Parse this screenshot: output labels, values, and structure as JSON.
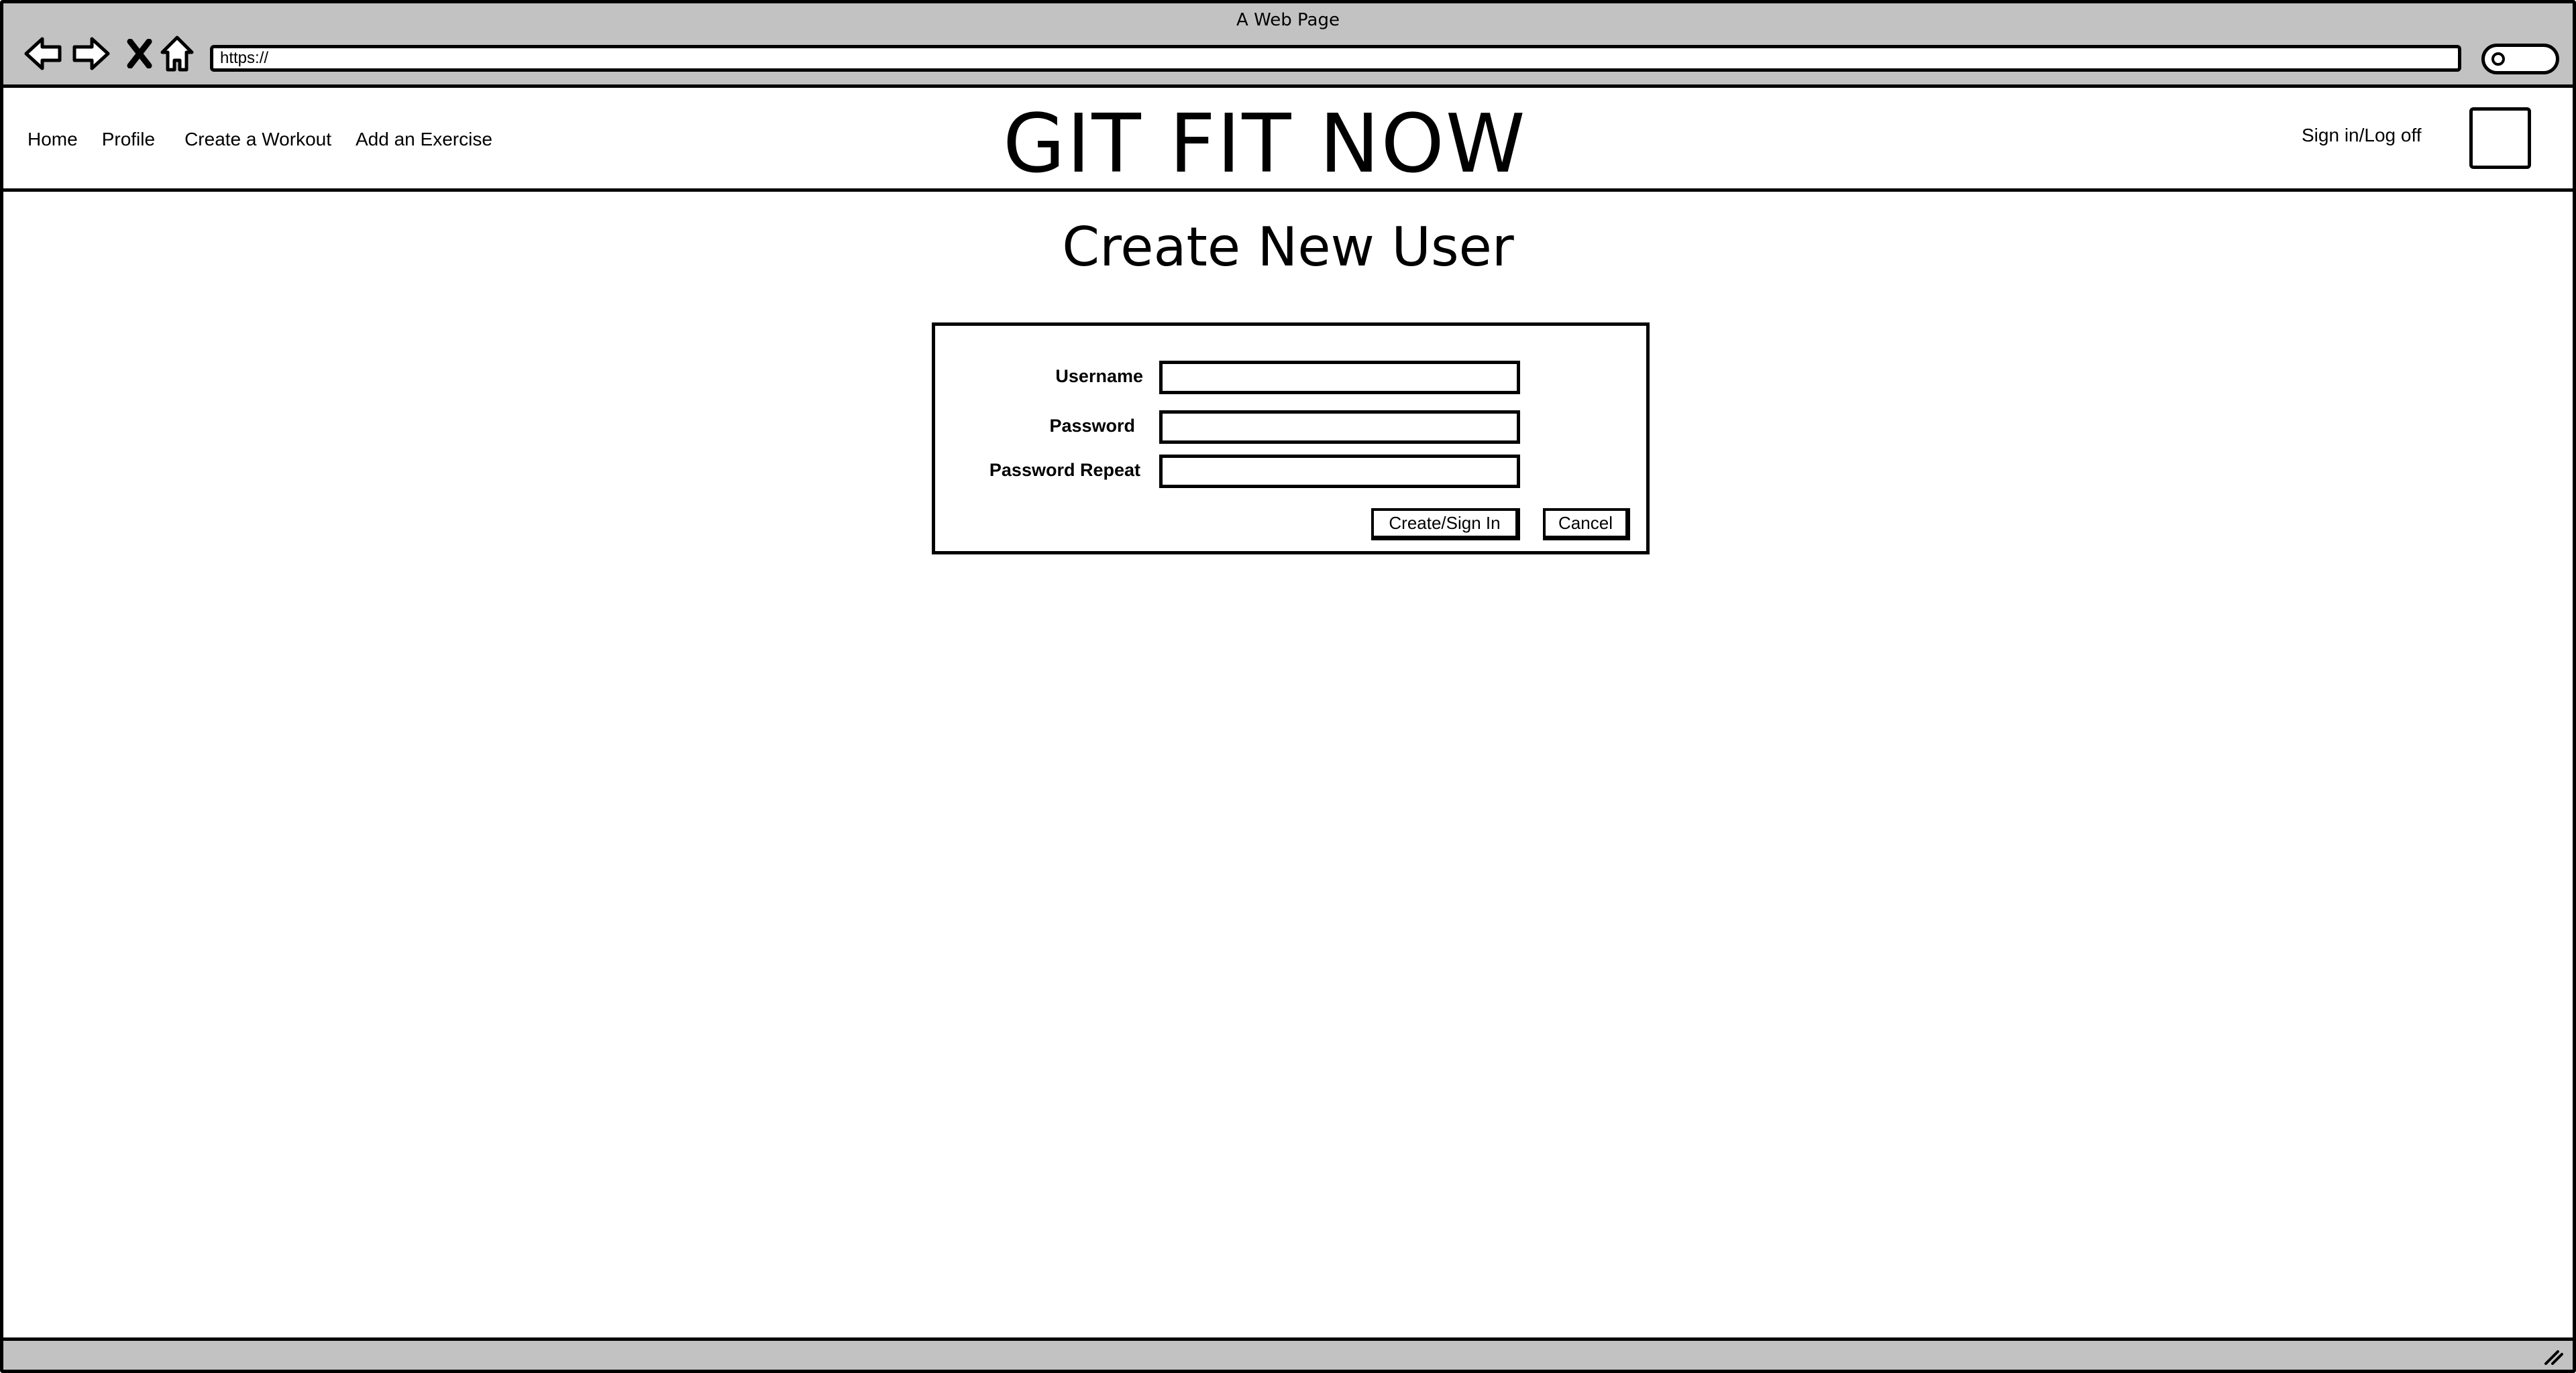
{
  "browser": {
    "window_title": "A Web Page",
    "url": "https://"
  },
  "site": {
    "brand": "GIT FIT NOW",
    "nav": [
      {
        "label": "Home"
      },
      {
        "label": "Profile"
      },
      {
        "label": "Create a Workout"
      },
      {
        "label": "Add an Exercise"
      }
    ],
    "signin_label": "Sign in/Log off"
  },
  "page": {
    "title": "Create New User"
  },
  "form": {
    "username_label": "Username",
    "password_label": "Password",
    "password_repeat_label": "Password Repeat",
    "username_value": "",
    "password_value": "",
    "password_repeat_value": "",
    "create_button": "Create/Sign In",
    "cancel_button": "Cancel"
  },
  "colors": {
    "chrome": "#c2c2c2",
    "ink": "#000000",
    "page": "#ffffff"
  }
}
